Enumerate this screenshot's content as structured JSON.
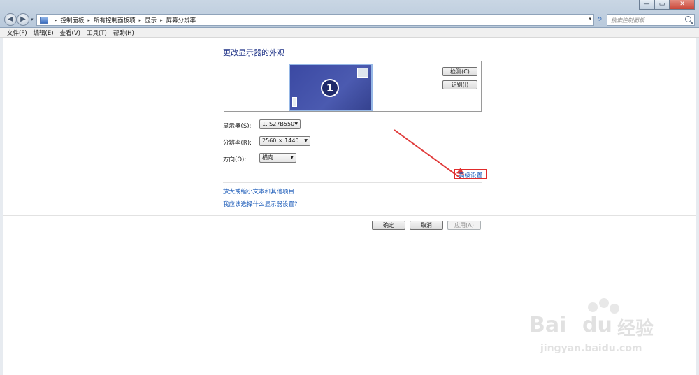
{
  "window": {
    "controls": {
      "minimize": "—",
      "maximize": "▭",
      "close": "✕"
    }
  },
  "nav": {
    "back": "◀",
    "forward": "▶",
    "history_dd": "▾",
    "refresh": "↻",
    "breadcrumbs": [
      "控制面板",
      "所有控制面板项",
      "显示",
      "屏幕分辨率"
    ],
    "sep": "▸",
    "addr_dd": "▾",
    "search_placeholder": "搜索控制面板"
  },
  "menubar": [
    "文件(F)",
    "编辑(E)",
    "查看(V)",
    "工具(T)",
    "帮助(H)"
  ],
  "main": {
    "title": "更改显示器的外观",
    "monitor_number": "1",
    "detect_label": "检测(C)",
    "identify_label": "识别(I)",
    "display_label": "显示器(S):",
    "display_value": "1. S27B550",
    "resolution_label": "分辨率(R):",
    "resolution_value": "2560 × 1440",
    "orientation_label": "方向(O):",
    "orientation_value": "横向",
    "advanced_link": "高级设置",
    "link_text_size": "放大或缩小文本和其他项目",
    "link_which_setting": "我应该选择什么显示器设置?",
    "ok_label": "确定",
    "cancel_label": "取消",
    "apply_label": "应用(A)"
  },
  "watermark": {
    "brand_a": "Bai",
    "brand_b": "du",
    "brand_cn": "经验",
    "url": "jingyan.baidu.com"
  },
  "colors": {
    "highlight_box": "#e02b2b",
    "link": "#1a5ab8",
    "title": "#1e3287"
  }
}
